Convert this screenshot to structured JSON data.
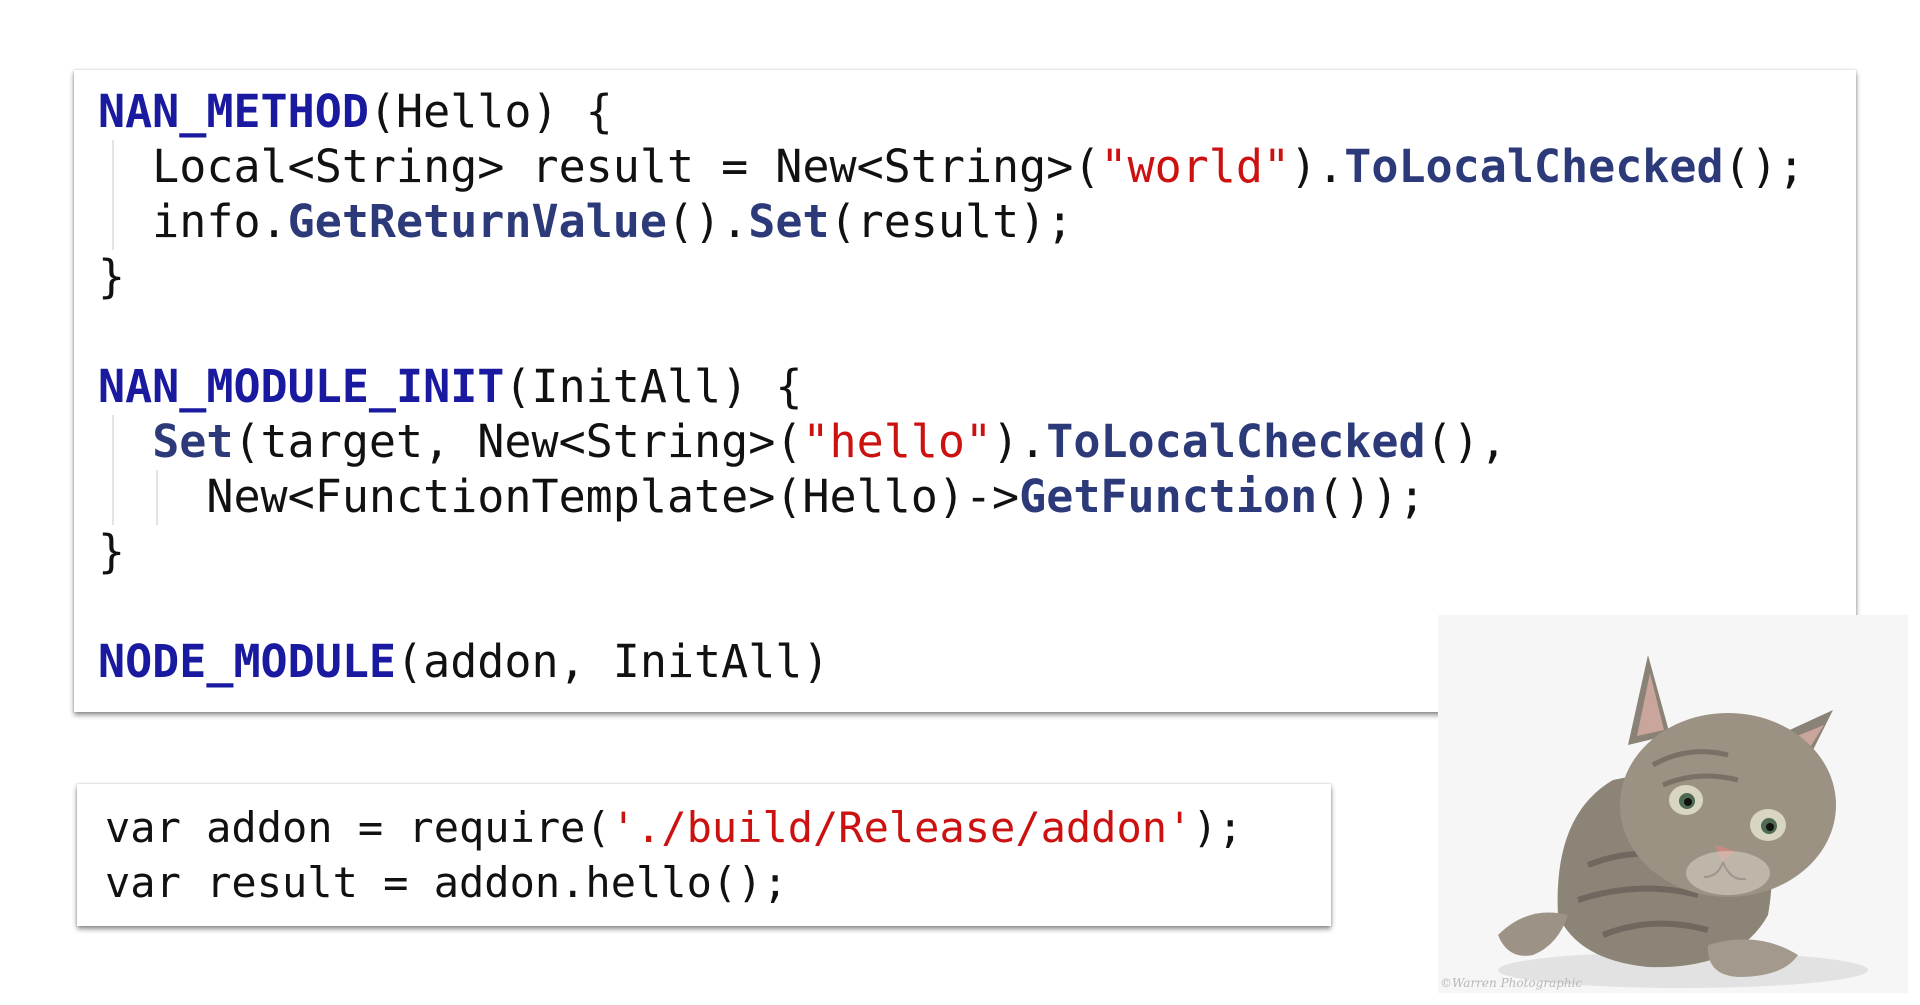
{
  "cpp_code": {
    "lines": [
      [
        {
          "t": "NAN_METHOD",
          "k": "kw"
        },
        {
          "t": "(Hello) {",
          "k": "plain"
        }
      ],
      [
        {
          "t": "  Local<String> result = New<String>(",
          "k": "plain"
        },
        {
          "t": "\"world\"",
          "k": "str"
        },
        {
          "t": ").",
          "k": "plain"
        },
        {
          "t": "ToLocalChecked",
          "k": "fn"
        },
        {
          "t": "();",
          "k": "plain"
        }
      ],
      [
        {
          "t": "  info.",
          "k": "plain"
        },
        {
          "t": "GetReturnValue",
          "k": "fn"
        },
        {
          "t": "().",
          "k": "plain"
        },
        {
          "t": "Set",
          "k": "fn"
        },
        {
          "t": "(result);",
          "k": "plain"
        }
      ],
      [
        {
          "t": "}",
          "k": "plain"
        }
      ],
      [],
      [
        {
          "t": "NAN_MODULE_INIT",
          "k": "kw"
        },
        {
          "t": "(InitAll) {",
          "k": "plain"
        }
      ],
      [
        {
          "t": "  ",
          "k": "plain"
        },
        {
          "t": "Set",
          "k": "fn"
        },
        {
          "t": "(target, New<String>(",
          "k": "plain"
        },
        {
          "t": "\"hello\"",
          "k": "str"
        },
        {
          "t": ").",
          "k": "plain"
        },
        {
          "t": "ToLocalChecked",
          "k": "fn"
        },
        {
          "t": "(),",
          "k": "plain"
        }
      ],
      [
        {
          "t": "    New<FunctionTemplate>(Hello)->",
          "k": "plain"
        },
        {
          "t": "GetFunction",
          "k": "fn"
        },
        {
          "t": "());",
          "k": "plain"
        }
      ],
      [
        {
          "t": "}",
          "k": "plain"
        }
      ],
      [],
      [
        {
          "t": "NODE_MODULE",
          "k": "kw"
        },
        {
          "t": "(addon, InitAll)",
          "k": "plain"
        }
      ]
    ]
  },
  "js_code": {
    "lines": [
      [
        {
          "t": "var addon = require(",
          "k": "plain"
        },
        {
          "t": "'./build/Release/addon'",
          "k": "str"
        },
        {
          "t": ");",
          "k": "plain"
        }
      ],
      [
        {
          "t": "var result = addon.hello();",
          "k": "plain"
        }
      ]
    ]
  },
  "photo": {
    "subject": "kitten",
    "credit": "©Warren Photographic"
  },
  "colors": {
    "keyword": "#1a1aa0",
    "function": "#2c3a7a",
    "string": "#cc1111",
    "text": "#111111"
  }
}
